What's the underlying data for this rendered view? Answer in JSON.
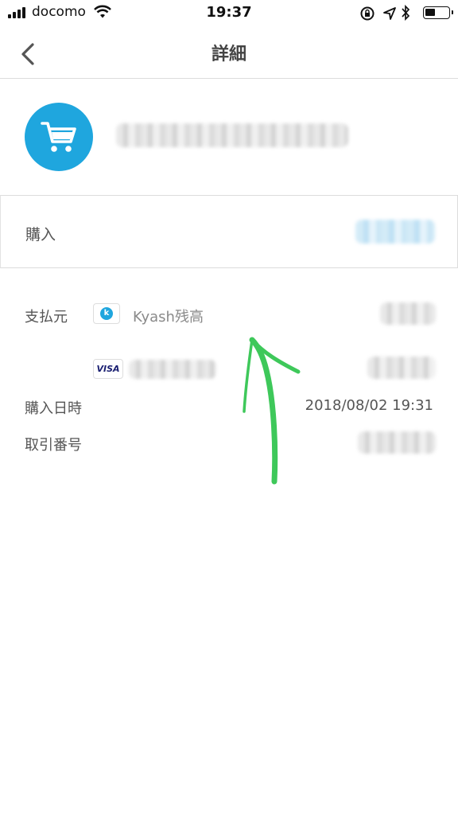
{
  "status_bar": {
    "carrier": "docomo",
    "time": "19:37"
  },
  "nav": {
    "title": "詳細"
  },
  "transaction": {
    "type_label": "購入"
  },
  "details": {
    "payment_source_label": "支払元",
    "payment_source_value": "Kyash残高",
    "card_brand": "VISA",
    "datetime_label": "購入日時",
    "datetime_value": "2018/08/02 19:31",
    "transaction_id_label": "取引番号"
  },
  "colors": {
    "accent_blue": "#1fa6de",
    "annotation_green": "#3ec85a"
  },
  "icons": {
    "back": "chevron-left-icon",
    "merchant": "cart-icon",
    "kyash": "kyash-logo-icon",
    "card": "visa-logo-icon"
  }
}
